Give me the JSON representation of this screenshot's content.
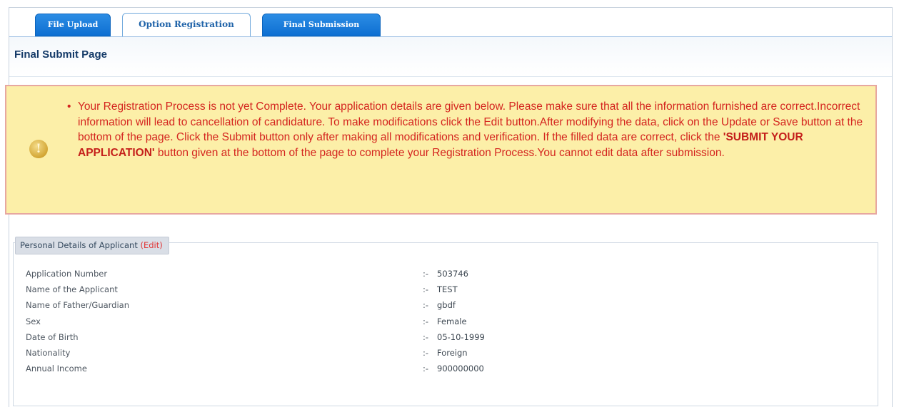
{
  "tabs": [
    {
      "label": "File Upload",
      "active": false
    },
    {
      "label": "Option Registration",
      "active": true
    },
    {
      "label": "Final Submission",
      "active": false
    }
  ],
  "page_title": "Final Submit Page",
  "alert": {
    "icon": "warning-icon",
    "text_before": "Your Registration Process is not yet Complete. Your application details are given below. Please make sure that all the information furnished are correct.Incorrect information will lead to cancellation of candidature. To make modifications click the Edit button.After modifying the data, click on the Update or Save button at the bottom of the page. Click the Submit button only after making all modifications and verification. If the filled data are correct, click the ",
    "text_bold": "'SUBMIT YOUR APPLICATION'",
    "text_after": " button given at the bottom of the page to complete your Registration Process.You cannot edit data after submission."
  },
  "personal_details": {
    "legend": "Personal Details of Applicant",
    "edit_label": "(Edit)",
    "separator": ":-",
    "rows": [
      {
        "label": "Application Number",
        "value": "503746"
      },
      {
        "label": "Name of the Applicant",
        "value": "TEST"
      },
      {
        "label": "Name of Father/Guardian",
        "value": "gbdf"
      },
      {
        "label": "Sex",
        "value": "Female"
      },
      {
        "label": "Date of Birth",
        "value": "05-10-1999"
      },
      {
        "label": "Nationality",
        "value": "Foreign"
      },
      {
        "label": "Annual Income",
        "value": "900000000"
      }
    ]
  },
  "colors": {
    "tab_blue": "#0d6fd2",
    "alert_bg": "#fcefa8",
    "alert_text": "#d4251f",
    "edit_link": "#e13333"
  }
}
